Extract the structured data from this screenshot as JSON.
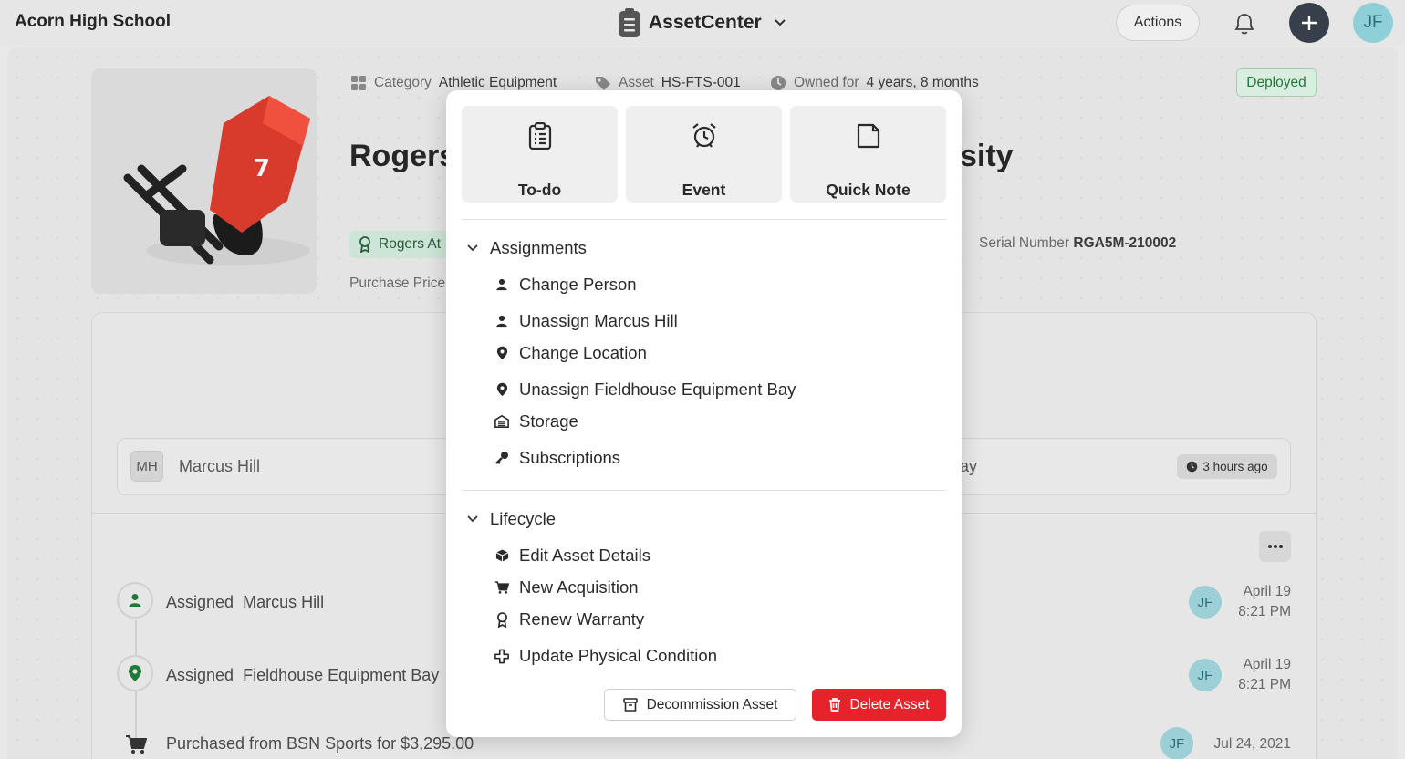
{
  "header": {
    "school": "Acorn High School",
    "app_name": "AssetCenter",
    "actions_label": "Actions",
    "user_initials": "JF"
  },
  "asset": {
    "category_label": "Category",
    "category_value": "Athletic Equipment",
    "asset_label": "Asset",
    "asset_value": "HS-FTS-001",
    "owned_label": "Owned for",
    "owned_value": "4 years, 8 months",
    "status": "Deployed",
    "title_left": "Rogers",
    "title_right": "sity",
    "cert_badge": "Rogers At",
    "serial_label": "Serial Number",
    "serial_value": "RGA5M-210002",
    "purchase_label": "Purchase Price"
  },
  "assignment": {
    "initials": "MH",
    "name": "Marcus Hill",
    "location_fragment": "ay",
    "time_ago": "3 hours ago"
  },
  "timeline": [
    {
      "verb": "Assigned",
      "subject": "Marcus Hill",
      "user": "JF",
      "date": "April 19",
      "time": "8:21 PM"
    },
    {
      "verb": "Assigned",
      "subject": "Fieldhouse Equipment Bay",
      "user": "JF",
      "date": "April 19",
      "time": "8:21 PM"
    },
    {
      "verb": "Purchased from BSN Sports for $3,295.00",
      "subject": "",
      "user": "JF",
      "date": "Jul 24, 2021",
      "time": ""
    }
  ],
  "popup": {
    "tiles": [
      "To-do",
      "Event",
      "Quick Note"
    ],
    "assignments": {
      "title": "Assignments",
      "items": [
        "Change Person",
        "Unassign Marcus Hill",
        "Change Location",
        "Unassign Fieldhouse Equipment Bay",
        "Storage",
        "Subscriptions"
      ]
    },
    "lifecycle": {
      "title": "Lifecycle",
      "items": [
        "Edit Asset Details",
        "New Acquisition",
        "Renew Warranty",
        "Update Physical Condition"
      ]
    },
    "decommission_label": "Decommission Asset",
    "delete_label": "Delete Asset"
  },
  "colors": {
    "delete": "#e8222b",
    "deployed_text": "#1f7a3a",
    "timeline_icon": "#1f7a3a",
    "avatar": "#8fd0d8"
  }
}
